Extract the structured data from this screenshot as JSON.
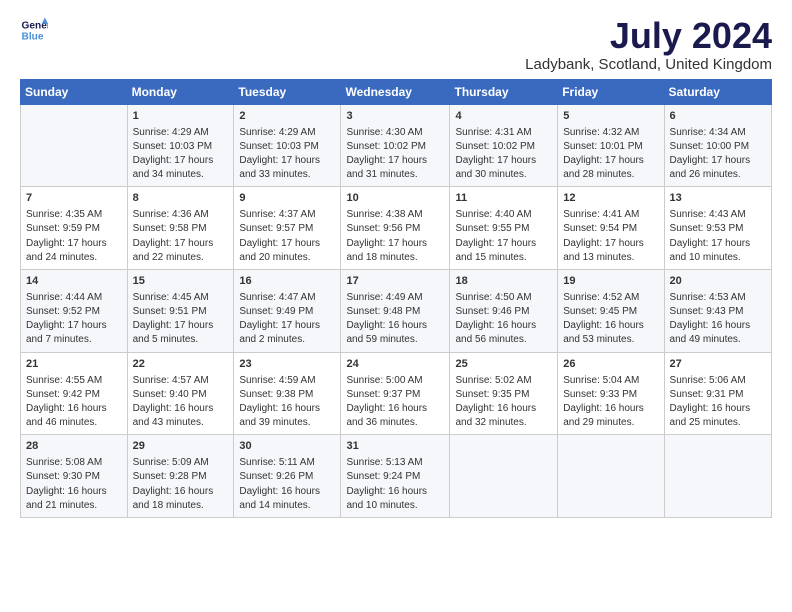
{
  "logo": {
    "line1": "General",
    "line2": "Blue"
  },
  "title": "July 2024",
  "location": "Ladybank, Scotland, United Kingdom",
  "headers": [
    "Sunday",
    "Monday",
    "Tuesday",
    "Wednesday",
    "Thursday",
    "Friday",
    "Saturday"
  ],
  "weeks": [
    [
      {
        "day": "",
        "content": ""
      },
      {
        "day": "1",
        "content": "Sunrise: 4:29 AM\nSunset: 10:03 PM\nDaylight: 17 hours\nand 34 minutes."
      },
      {
        "day": "2",
        "content": "Sunrise: 4:29 AM\nSunset: 10:03 PM\nDaylight: 17 hours\nand 33 minutes."
      },
      {
        "day": "3",
        "content": "Sunrise: 4:30 AM\nSunset: 10:02 PM\nDaylight: 17 hours\nand 31 minutes."
      },
      {
        "day": "4",
        "content": "Sunrise: 4:31 AM\nSunset: 10:02 PM\nDaylight: 17 hours\nand 30 minutes."
      },
      {
        "day": "5",
        "content": "Sunrise: 4:32 AM\nSunset: 10:01 PM\nDaylight: 17 hours\nand 28 minutes."
      },
      {
        "day": "6",
        "content": "Sunrise: 4:34 AM\nSunset: 10:00 PM\nDaylight: 17 hours\nand 26 minutes."
      }
    ],
    [
      {
        "day": "7",
        "content": "Sunrise: 4:35 AM\nSunset: 9:59 PM\nDaylight: 17 hours\nand 24 minutes."
      },
      {
        "day": "8",
        "content": "Sunrise: 4:36 AM\nSunset: 9:58 PM\nDaylight: 17 hours\nand 22 minutes."
      },
      {
        "day": "9",
        "content": "Sunrise: 4:37 AM\nSunset: 9:57 PM\nDaylight: 17 hours\nand 20 minutes."
      },
      {
        "day": "10",
        "content": "Sunrise: 4:38 AM\nSunset: 9:56 PM\nDaylight: 17 hours\nand 18 minutes."
      },
      {
        "day": "11",
        "content": "Sunrise: 4:40 AM\nSunset: 9:55 PM\nDaylight: 17 hours\nand 15 minutes."
      },
      {
        "day": "12",
        "content": "Sunrise: 4:41 AM\nSunset: 9:54 PM\nDaylight: 17 hours\nand 13 minutes."
      },
      {
        "day": "13",
        "content": "Sunrise: 4:43 AM\nSunset: 9:53 PM\nDaylight: 17 hours\nand 10 minutes."
      }
    ],
    [
      {
        "day": "14",
        "content": "Sunrise: 4:44 AM\nSunset: 9:52 PM\nDaylight: 17 hours\nand 7 minutes."
      },
      {
        "day": "15",
        "content": "Sunrise: 4:45 AM\nSunset: 9:51 PM\nDaylight: 17 hours\nand 5 minutes."
      },
      {
        "day": "16",
        "content": "Sunrise: 4:47 AM\nSunset: 9:49 PM\nDaylight: 17 hours\nand 2 minutes."
      },
      {
        "day": "17",
        "content": "Sunrise: 4:49 AM\nSunset: 9:48 PM\nDaylight: 16 hours\nand 59 minutes."
      },
      {
        "day": "18",
        "content": "Sunrise: 4:50 AM\nSunset: 9:46 PM\nDaylight: 16 hours\nand 56 minutes."
      },
      {
        "day": "19",
        "content": "Sunrise: 4:52 AM\nSunset: 9:45 PM\nDaylight: 16 hours\nand 53 minutes."
      },
      {
        "day": "20",
        "content": "Sunrise: 4:53 AM\nSunset: 9:43 PM\nDaylight: 16 hours\nand 49 minutes."
      }
    ],
    [
      {
        "day": "21",
        "content": "Sunrise: 4:55 AM\nSunset: 9:42 PM\nDaylight: 16 hours\nand 46 minutes."
      },
      {
        "day": "22",
        "content": "Sunrise: 4:57 AM\nSunset: 9:40 PM\nDaylight: 16 hours\nand 43 minutes."
      },
      {
        "day": "23",
        "content": "Sunrise: 4:59 AM\nSunset: 9:38 PM\nDaylight: 16 hours\nand 39 minutes."
      },
      {
        "day": "24",
        "content": "Sunrise: 5:00 AM\nSunset: 9:37 PM\nDaylight: 16 hours\nand 36 minutes."
      },
      {
        "day": "25",
        "content": "Sunrise: 5:02 AM\nSunset: 9:35 PM\nDaylight: 16 hours\nand 32 minutes."
      },
      {
        "day": "26",
        "content": "Sunrise: 5:04 AM\nSunset: 9:33 PM\nDaylight: 16 hours\nand 29 minutes."
      },
      {
        "day": "27",
        "content": "Sunrise: 5:06 AM\nSunset: 9:31 PM\nDaylight: 16 hours\nand 25 minutes."
      }
    ],
    [
      {
        "day": "28",
        "content": "Sunrise: 5:08 AM\nSunset: 9:30 PM\nDaylight: 16 hours\nand 21 minutes."
      },
      {
        "day": "29",
        "content": "Sunrise: 5:09 AM\nSunset: 9:28 PM\nDaylight: 16 hours\nand 18 minutes."
      },
      {
        "day": "30",
        "content": "Sunrise: 5:11 AM\nSunset: 9:26 PM\nDaylight: 16 hours\nand 14 minutes."
      },
      {
        "day": "31",
        "content": "Sunrise: 5:13 AM\nSunset: 9:24 PM\nDaylight: 16 hours\nand 10 minutes."
      },
      {
        "day": "",
        "content": ""
      },
      {
        "day": "",
        "content": ""
      },
      {
        "day": "",
        "content": ""
      }
    ]
  ]
}
